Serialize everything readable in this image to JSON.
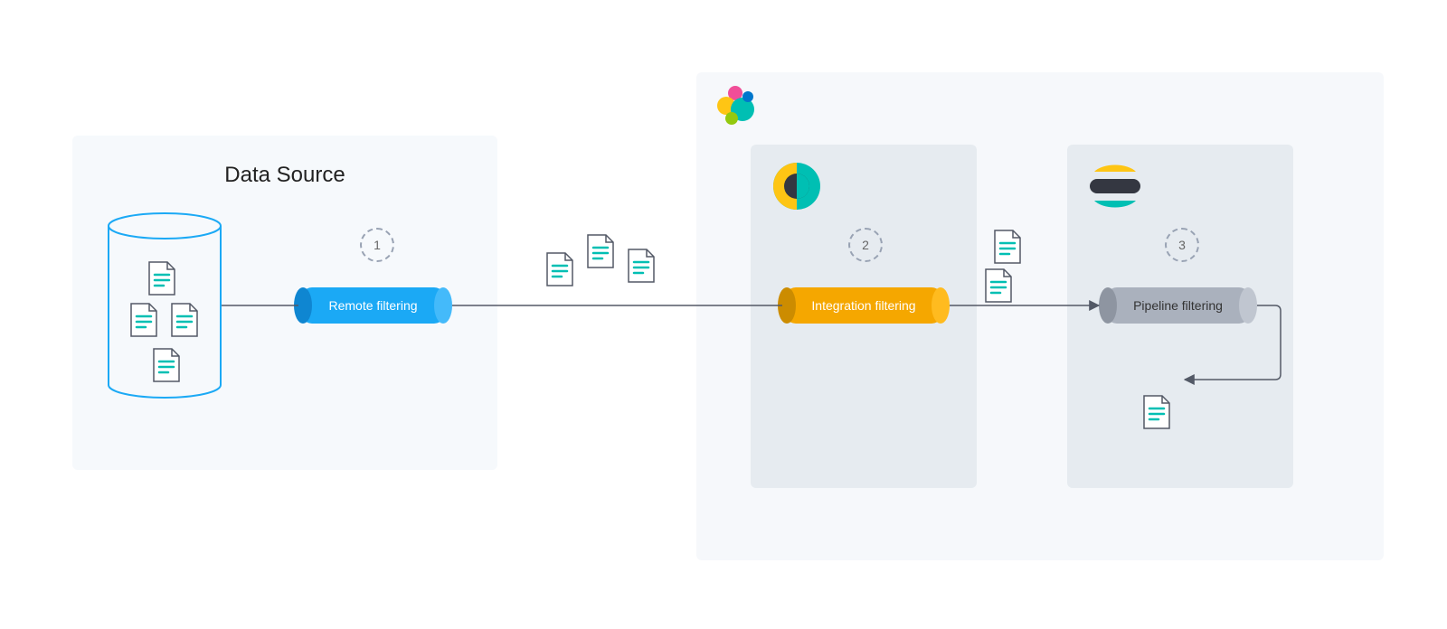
{
  "source": {
    "title": "Data Source"
  },
  "steps": {
    "s1": {
      "num": "1",
      "label": "Remote filtering"
    },
    "s2": {
      "num": "2",
      "label": "Integration filtering"
    },
    "s3": {
      "num": "3",
      "label": "Pipeline filtering"
    }
  },
  "colors": {
    "blue": "#1ba9f5",
    "amber": "#f5a700",
    "gray": "#aab1bd",
    "teal": "#00bfb3",
    "yellow": "#fec514",
    "dark": "#343741",
    "pink": "#f04e98",
    "green": "#7de2d1",
    "outline": "#535966"
  }
}
